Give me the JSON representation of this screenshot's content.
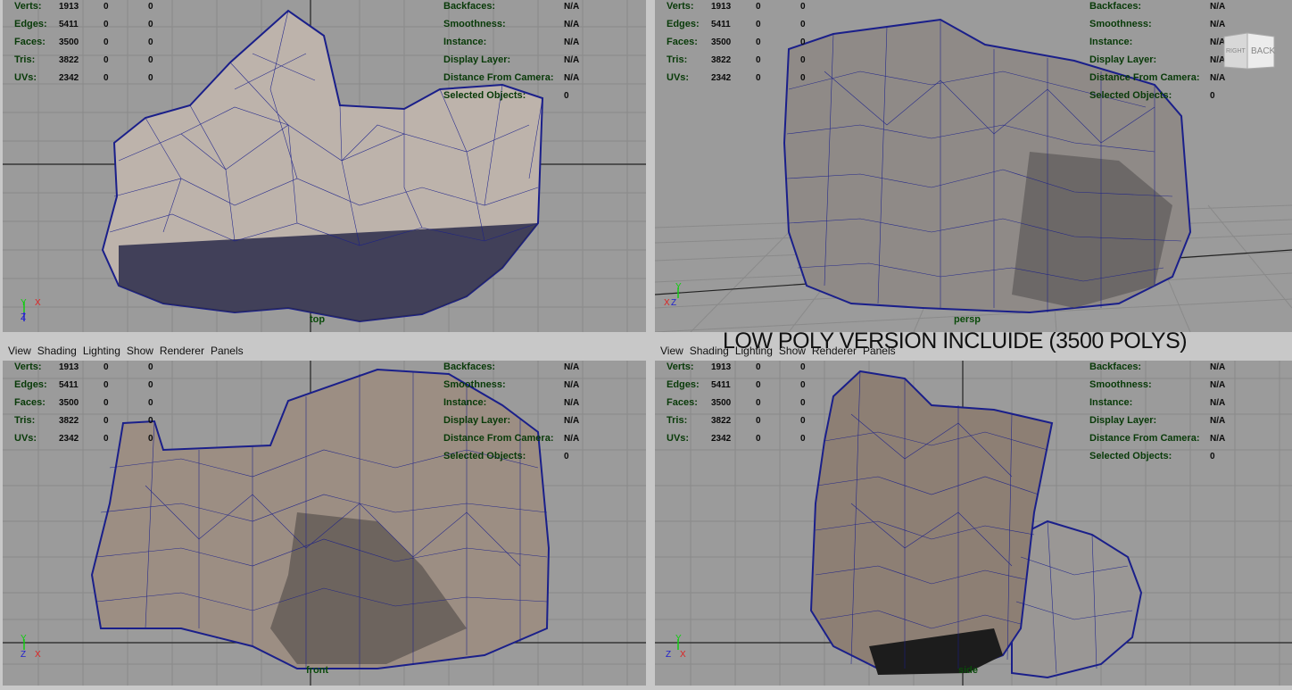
{
  "overlay_caption": "LOW POLY VERSION INCLUIDE (3500 POLYS)",
  "menu": [
    "View",
    "Shading",
    "Lighting",
    "Show",
    "Renderer",
    "Panels"
  ],
  "hud_left": [
    {
      "label": "Verts:",
      "v1": "1913",
      "v2": "0",
      "v3": "0"
    },
    {
      "label": "Edges:",
      "v1": "5411",
      "v2": "0",
      "v3": "0"
    },
    {
      "label": "Faces:",
      "v1": "3500",
      "v2": "0",
      "v3": "0"
    },
    {
      "label": "Tris:",
      "v1": "3822",
      "v2": "0",
      "v3": "0"
    },
    {
      "label": "UVs:",
      "v1": "2342",
      "v2": "0",
      "v3": "0"
    }
  ],
  "hud_right": [
    {
      "label": "Backfaces:",
      "value": "N/A"
    },
    {
      "label": "Smoothness:",
      "value": "N/A"
    },
    {
      "label": "Instance:",
      "value": "N/A"
    },
    {
      "label": "Display Layer:",
      "value": "N/A"
    },
    {
      "label": "Distance From Camera:",
      "value": "N/A"
    },
    {
      "label": "Selected Objects:",
      "value": "0"
    }
  ],
  "cameras": {
    "top": "top",
    "persp": "persp",
    "front": "front",
    "side": "side"
  },
  "viewcube": {
    "right": "RIGHT",
    "back": "BACK"
  },
  "axes": {
    "x": "X",
    "y": "Y",
    "z": "Z"
  },
  "colors": {
    "viewport_bg": "#9b9b9b",
    "wire": "#1a1f8a",
    "hud_green": "#083a08",
    "axis_x": "#d22",
    "axis_y": "#1c1",
    "axis_z": "#22c"
  }
}
